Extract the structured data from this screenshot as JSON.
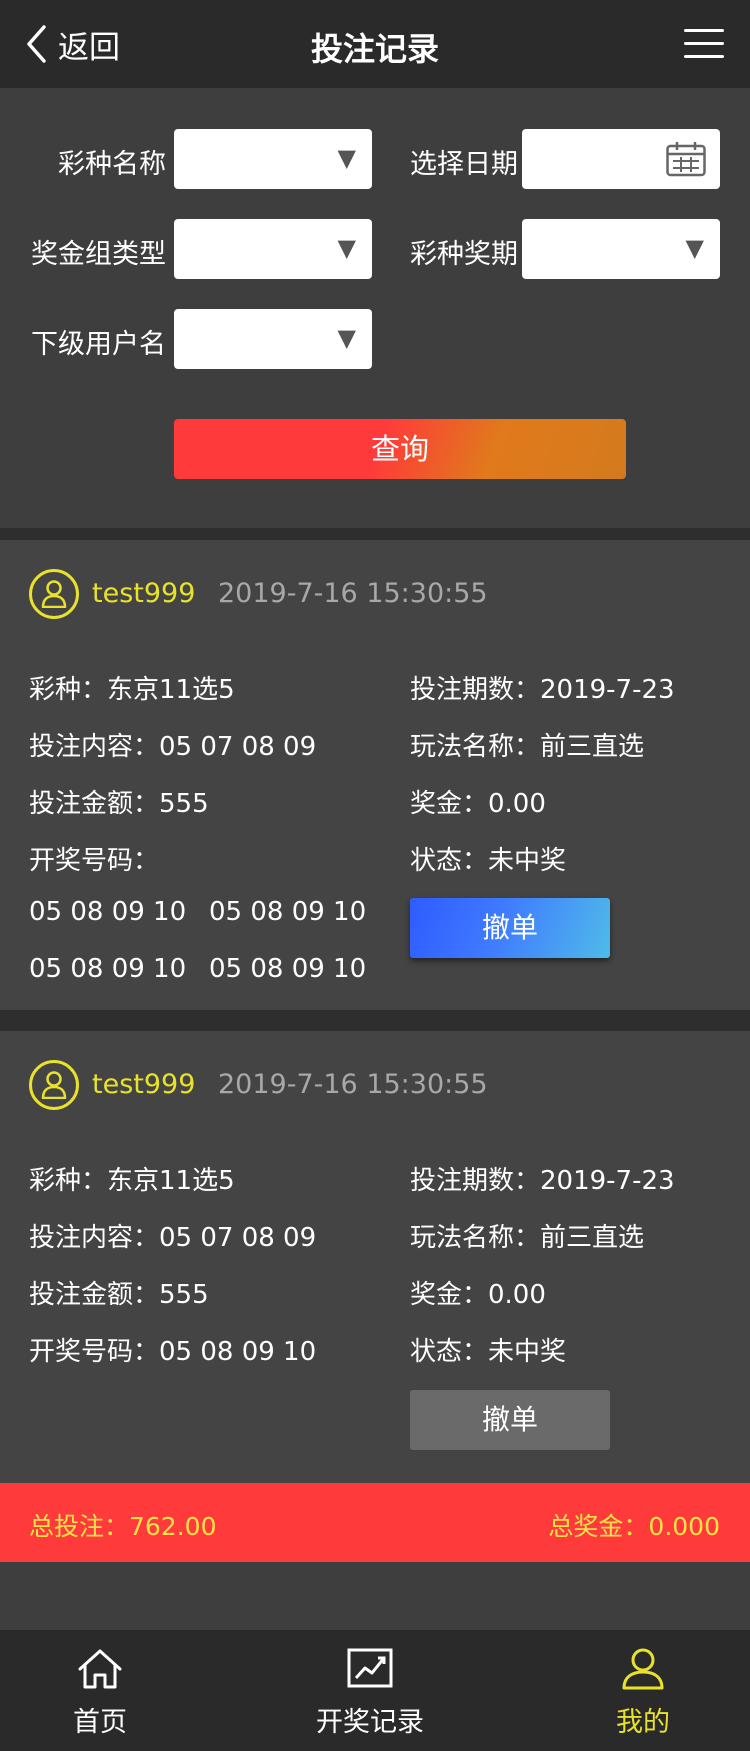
{
  "header": {
    "back_label": "返回",
    "title": "投注记录"
  },
  "filter": {
    "lottery_name_label": "彩种名称",
    "date_label": "选择日期",
    "prize_group_label": "奖金组类型",
    "issue_label": "彩种奖期",
    "sub_user_label": "下级用户名",
    "search_label": "查询",
    "dropdown_arrow": "▼"
  },
  "records": [
    {
      "user": "test999",
      "time": "2019-7-16 15:30:55",
      "lottery": "彩种：东京11选5",
      "period": "投注期数：2019-7-23",
      "content": "投注内容：05 07 08 09",
      "play": "玩法名称：前三直选",
      "amount": "投注金额：555",
      "prize": "奖金：0.00",
      "draw_label": "开奖号码：",
      "status": "状态：未中奖",
      "draw_1": "05 08 09 10",
      "draw_2": "05 08 09 10",
      "draw_3": "05 08 09 10",
      "draw_4": "05 08 09 10",
      "cancel": "撤单"
    },
    {
      "user": "test999",
      "time": "2019-7-16 15:30:55",
      "lottery": "彩种：东京11选5",
      "period": "投注期数：2019-7-23",
      "content": "投注内容：05 07 08 09",
      "play": "玩法名称：前三直选",
      "amount": "投注金额：555",
      "prize": "奖金：0.00",
      "draw": "开奖号码：05 08 09 10",
      "status": "状态：未中奖",
      "cancel": "撤单"
    }
  ],
  "totals": {
    "total_bet": "总投注：762.00",
    "total_prize": "总奖金：0.000"
  },
  "nav": {
    "home": "首页",
    "draw_history": "开奖记录",
    "mine": "我的"
  },
  "colors": {
    "accent_yellow": "#e8e22a",
    "red": "#ff3a3a",
    "blue": "#3f7cff"
  }
}
